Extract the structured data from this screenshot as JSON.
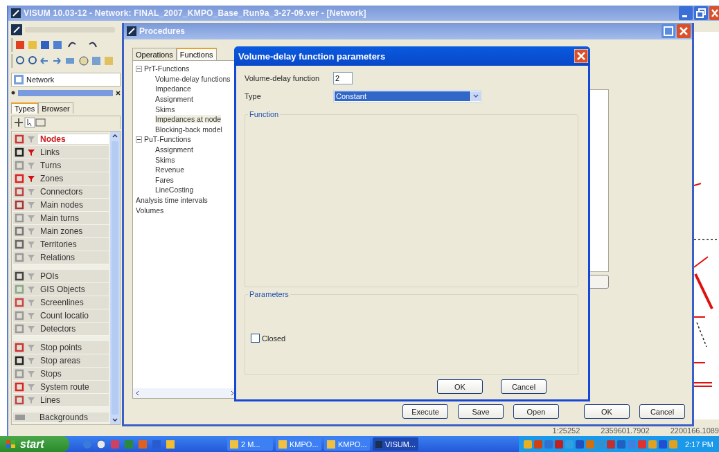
{
  "main_window": {
    "title": "VISUM 10.03-12 - Network: FINAL_2007_KMPO_Base_Run9a_3-27-09.ver - [Network]"
  },
  "network_selector": {
    "value": "Network"
  },
  "object_tabs": [
    {
      "label": "Types",
      "selected": true
    },
    {
      "label": "Browser",
      "selected": false
    }
  ],
  "object_groups": [
    [
      {
        "label": "Nodes",
        "selected": true,
        "filter": false
      },
      {
        "label": "Links",
        "selected": false,
        "filter": true
      },
      {
        "label": "Turns",
        "selected": false,
        "filter": false
      },
      {
        "label": "Zones",
        "selected": false,
        "filter": true
      },
      {
        "label": "Connectors",
        "selected": false,
        "filter": false
      },
      {
        "label": "Main nodes",
        "selected": false,
        "filter": false
      },
      {
        "label": "Main turns",
        "selected": false,
        "filter": false
      },
      {
        "label": "Main zones",
        "selected": false,
        "filter": false
      },
      {
        "label": "Territories",
        "selected": false,
        "filter": false
      },
      {
        "label": "Relations",
        "selected": false,
        "filter": false
      }
    ],
    [
      {
        "label": "POIs",
        "selected": false,
        "filter": false
      },
      {
        "label": "GIS Objects",
        "selected": false,
        "filter": false
      },
      {
        "label": "Screenlines",
        "selected": false,
        "filter": false
      },
      {
        "label": "Count locatio",
        "selected": false,
        "filter": false
      },
      {
        "label": "Detectors",
        "selected": false,
        "filter": false
      }
    ],
    [
      {
        "label": "Stop points",
        "selected": false,
        "filter": false
      },
      {
        "label": "Stop areas",
        "selected": false,
        "filter": false
      },
      {
        "label": "Stops",
        "selected": false,
        "filter": false
      },
      {
        "label": "System route",
        "selected": false,
        "filter": false
      },
      {
        "label": "Lines",
        "selected": false,
        "filter": false
      }
    ]
  ],
  "background_item": {
    "label": "Backgrounds"
  },
  "procedures": {
    "title": "Procedures",
    "tabs": [
      {
        "label": "Operations",
        "selected": false
      },
      {
        "label": "Functions",
        "selected": true
      }
    ],
    "tree": [
      {
        "label": "PrT-Functions",
        "expanded": true,
        "selected": false,
        "children": [
          {
            "label": "Volume-delay functions",
            "selected": false
          },
          {
            "label": "Impedance",
            "selected": false
          },
          {
            "label": "Assignment",
            "selected": false
          },
          {
            "label": "Skims",
            "selected": false
          },
          {
            "label": "Impedances at node",
            "selected": true
          },
          {
            "label": "Blocking-back model",
            "selected": false
          }
        ]
      },
      {
        "label": "PuT-Functions",
        "expanded": true,
        "selected": false,
        "children": [
          {
            "label": "Assignment",
            "selected": false
          },
          {
            "label": "Skims",
            "selected": false
          },
          {
            "label": "Revenue",
            "selected": false
          },
          {
            "label": "Fares",
            "selected": false
          },
          {
            "label": "LineCosting",
            "selected": false
          }
        ]
      },
      {
        "label": "Analysis time intervals",
        "selected": false
      },
      {
        "label": "Volumes",
        "selected": false
      }
    ],
    "buttons": [
      "Execute",
      "Save",
      "Open",
      "OK",
      "Cancel"
    ]
  },
  "dialog": {
    "title": "Volume-delay function parameters",
    "fields": [
      {
        "label": "Volume-delay function",
        "kind": "text",
        "value": "2"
      },
      {
        "label": "Type",
        "kind": "dropdown",
        "value": "Constant"
      }
    ],
    "function_group": {
      "title": "Function"
    },
    "parameters_group": {
      "title": "Parameters"
    },
    "closed": {
      "label": "Closed",
      "checked": false
    },
    "buttons": [
      "OK",
      "Cancel"
    ]
  },
  "status_bar": [
    "1:25252",
    "2359601.7902",
    "2200166.1089"
  ],
  "taskbar": {
    "start": "start",
    "tasks": [
      {
        "label": "2 M...",
        "selected": false
      },
      {
        "label": "KMPO...",
        "selected": false
      },
      {
        "label": "KMPO...",
        "selected": false
      },
      {
        "label": "VISUM...",
        "selected": true
      }
    ],
    "clock": "2:17 PM"
  }
}
